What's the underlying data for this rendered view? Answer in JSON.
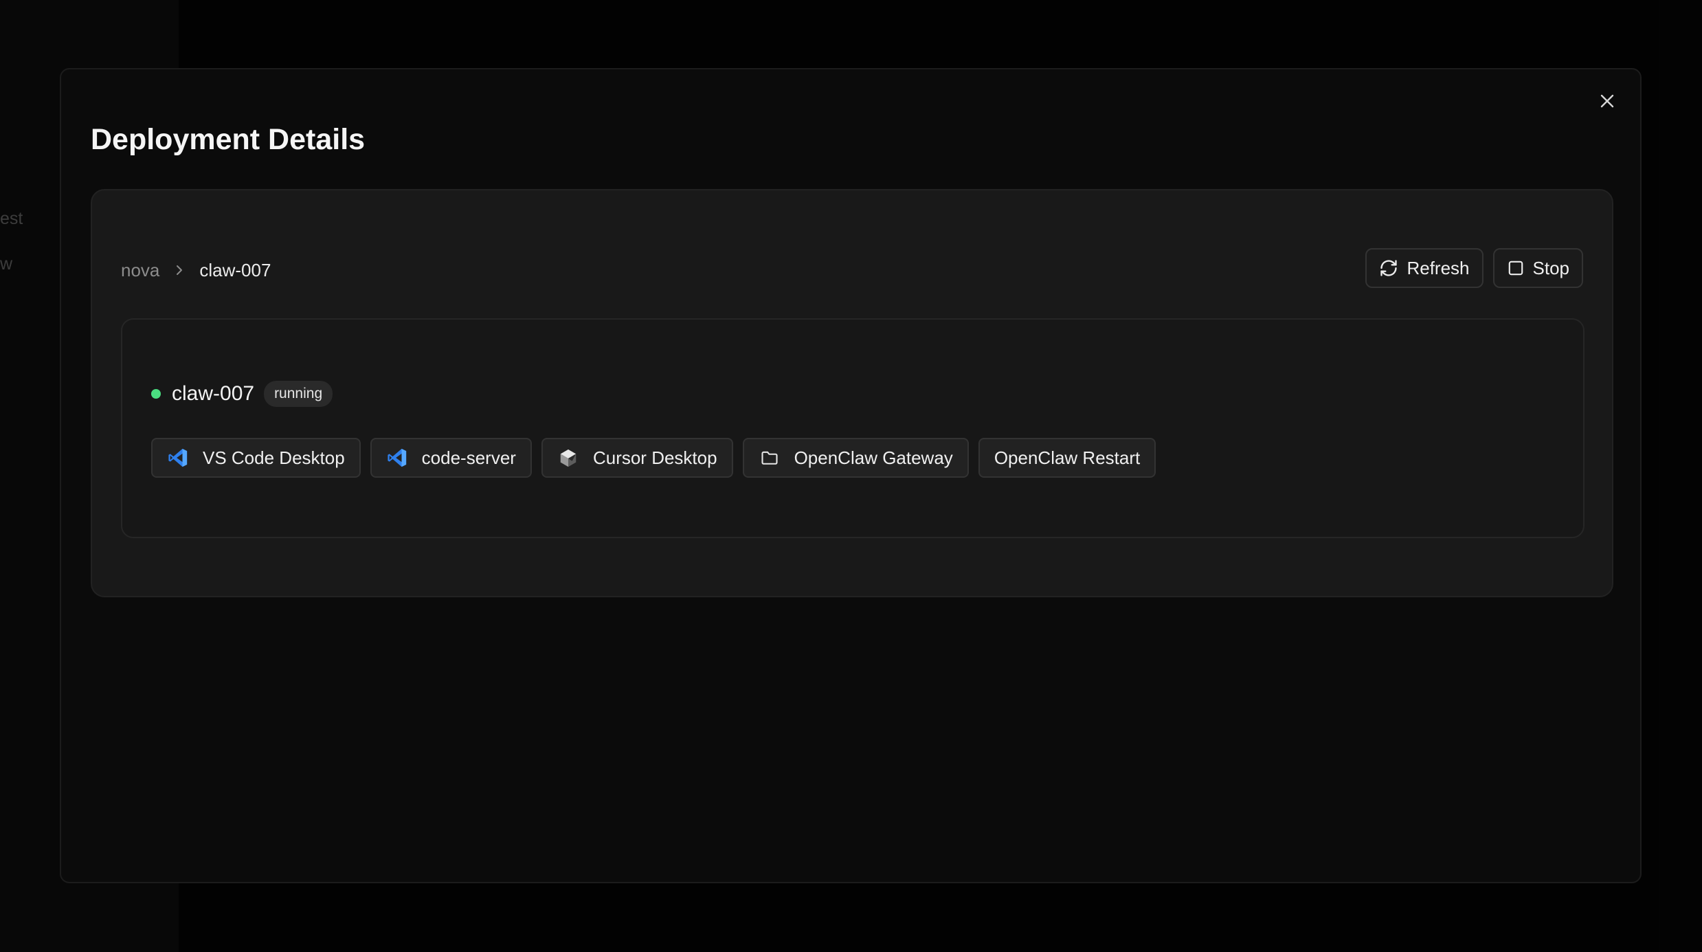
{
  "background": {
    "sidebar_fragments": [
      "est",
      "w"
    ]
  },
  "modal": {
    "title": "Deployment Details",
    "close_icon": "close-icon"
  },
  "breadcrumb": {
    "root": "nova",
    "current": "claw-007"
  },
  "actions": {
    "refresh_label": "Refresh",
    "stop_label": "Stop"
  },
  "deployment": {
    "name": "claw-007",
    "status": "running",
    "status_color": "#4ade80"
  },
  "tools": [
    {
      "label": "VS Code Desktop",
      "icon": "vscode-icon"
    },
    {
      "label": "code-server",
      "icon": "vscode-icon"
    },
    {
      "label": "Cursor Desktop",
      "icon": "cursor-icon"
    },
    {
      "label": "OpenClaw Gateway",
      "icon": "folder-icon"
    },
    {
      "label": "OpenClaw Restart",
      "icon": ""
    }
  ]
}
